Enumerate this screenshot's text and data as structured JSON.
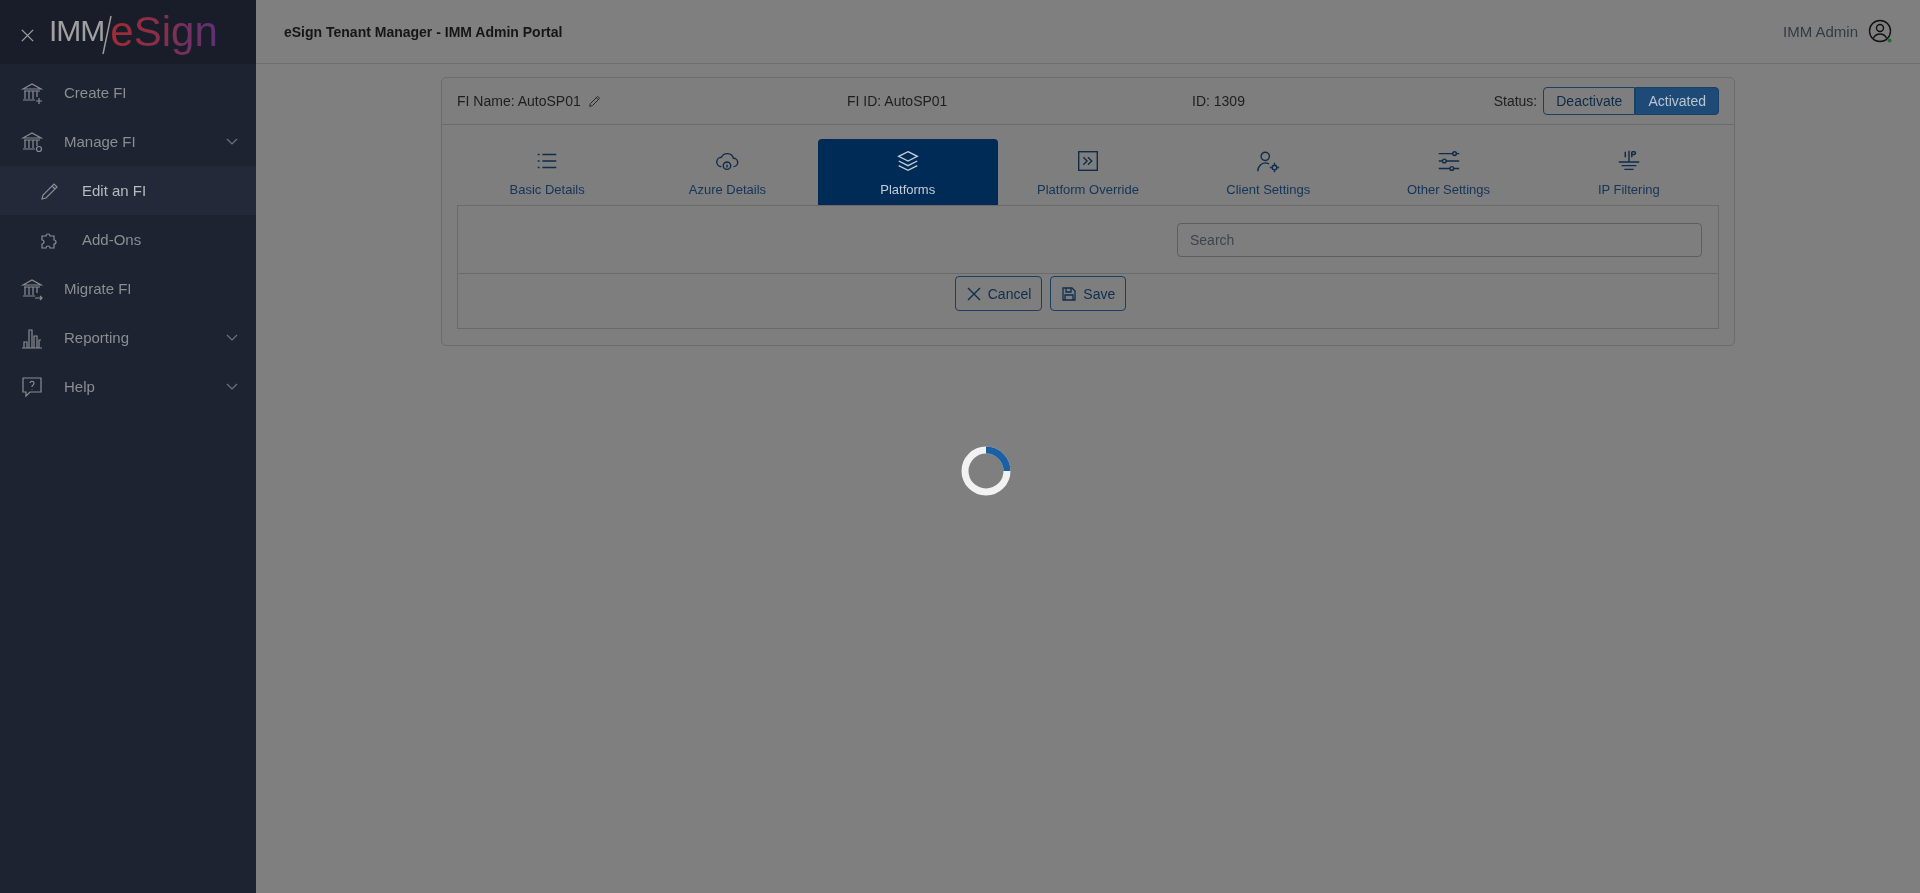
{
  "logo": {
    "prefix": "IMM",
    "name": "eSign"
  },
  "sidebar": {
    "items": [
      {
        "label": "Create FI",
        "kind": "link",
        "selected": false
      },
      {
        "label": "Manage FI",
        "kind": "group",
        "selected": false,
        "children": [
          {
            "label": "Edit an FI",
            "selected": true
          },
          {
            "label": "Add-Ons",
            "selected": false
          }
        ]
      },
      {
        "label": "Migrate FI",
        "kind": "link",
        "selected": false
      },
      {
        "label": "Reporting",
        "kind": "group",
        "selected": false
      },
      {
        "label": "Help",
        "kind": "group",
        "selected": false
      }
    ]
  },
  "header": {
    "title": "eSign Tenant Manager - IMM Admin Portal",
    "user": "IMM Admin",
    "online": true
  },
  "fi": {
    "name_label": "FI Name:",
    "name": "AutoSP01",
    "fi_id": "FI ID: AutoSP01",
    "id": "ID: 1309",
    "status_label": "Status:",
    "status_options": [
      {
        "label": "Deactivate",
        "selected": false
      },
      {
        "label": "Activated",
        "selected": true
      }
    ]
  },
  "tabs": [
    {
      "label": "Basic Details",
      "selected": false
    },
    {
      "label": "Azure Details",
      "selected": false
    },
    {
      "label": "Platforms",
      "selected": true
    },
    {
      "label": "Platform Override",
      "selected": false
    },
    {
      "label": "Client Settings",
      "selected": false
    },
    {
      "label": "Other Settings",
      "selected": false
    },
    {
      "label": "IP Filtering",
      "selected": false
    }
  ],
  "search": {
    "placeholder": "Search"
  },
  "buttons": [
    {
      "label": "Cancel",
      "kind": "cancel"
    },
    {
      "label": "Save",
      "kind": "save"
    }
  ],
  "loading": true
}
